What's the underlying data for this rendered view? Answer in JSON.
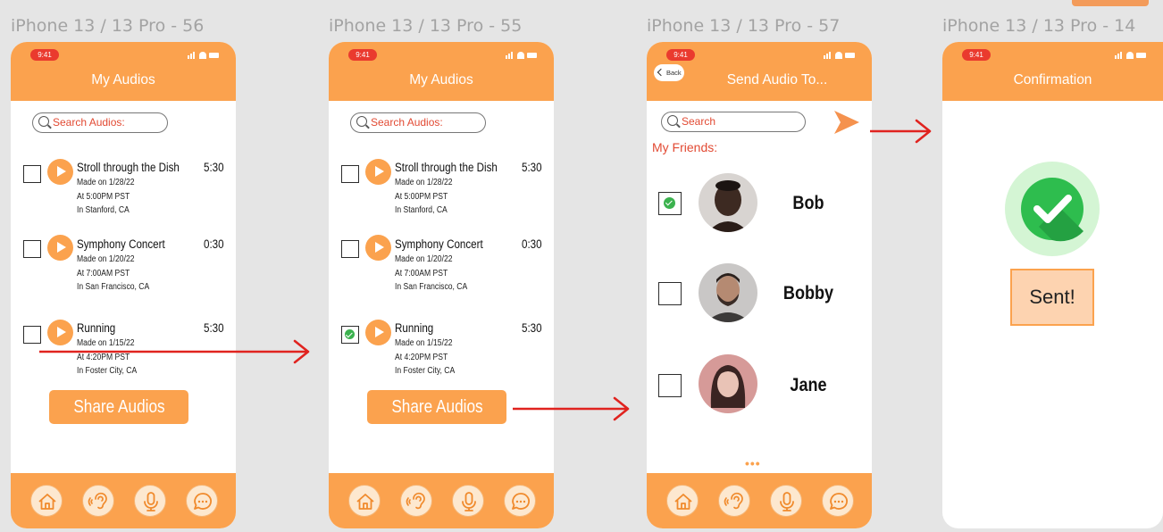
{
  "frames": [
    {
      "title": "iPhone 13 / 13 Pro - 56",
      "screen_title": "My Audios"
    },
    {
      "title": "iPhone 13 / 13 Pro - 55",
      "screen_title": "My Audios"
    },
    {
      "title": "iPhone 13 / 13 Pro - 57",
      "screen_title": "Send Audio To..."
    },
    {
      "title": "iPhone 13 / 13 Pro - 14",
      "screen_title": "Confirmation"
    }
  ],
  "status": {
    "time": "9:41"
  },
  "search": {
    "audios_placeholder": "Search Audios:",
    "friends_placeholder": "Search"
  },
  "audios": [
    {
      "title": "Stroll through the Dish",
      "duration": "5:30",
      "made": "Made on 1/28/22",
      "time": "At 5:00PM PST",
      "place": "In Stanford, CA"
    },
    {
      "title": "Symphony Concert",
      "duration": "0:30",
      "made": "Made on 1/20/22",
      "time": "At 7:00AM PST",
      "place": "In San Francisco, CA"
    },
    {
      "title": "Running",
      "duration": "5:30",
      "made": "Made on 1/15/22",
      "time": "At 4:20PM PST",
      "place": "In Foster City, CA"
    }
  ],
  "screen55_checked": [
    false,
    false,
    true
  ],
  "share_label": "Share Audios",
  "back_label": "Back",
  "friends_label": "My Friends:",
  "friends": [
    {
      "name": "Bob",
      "checked": true
    },
    {
      "name": "Bobby",
      "checked": false
    },
    {
      "name": "Jane",
      "checked": false
    }
  ],
  "more_label": "•••",
  "sent_label": "Sent!",
  "tabs": [
    "home-icon",
    "ear-icon",
    "microphone-icon",
    "chat-icon"
  ],
  "colors": {
    "accent": "#fba24e",
    "alert": "#e24a33",
    "arrow": "#e0231f",
    "success": "#3bb24e"
  }
}
